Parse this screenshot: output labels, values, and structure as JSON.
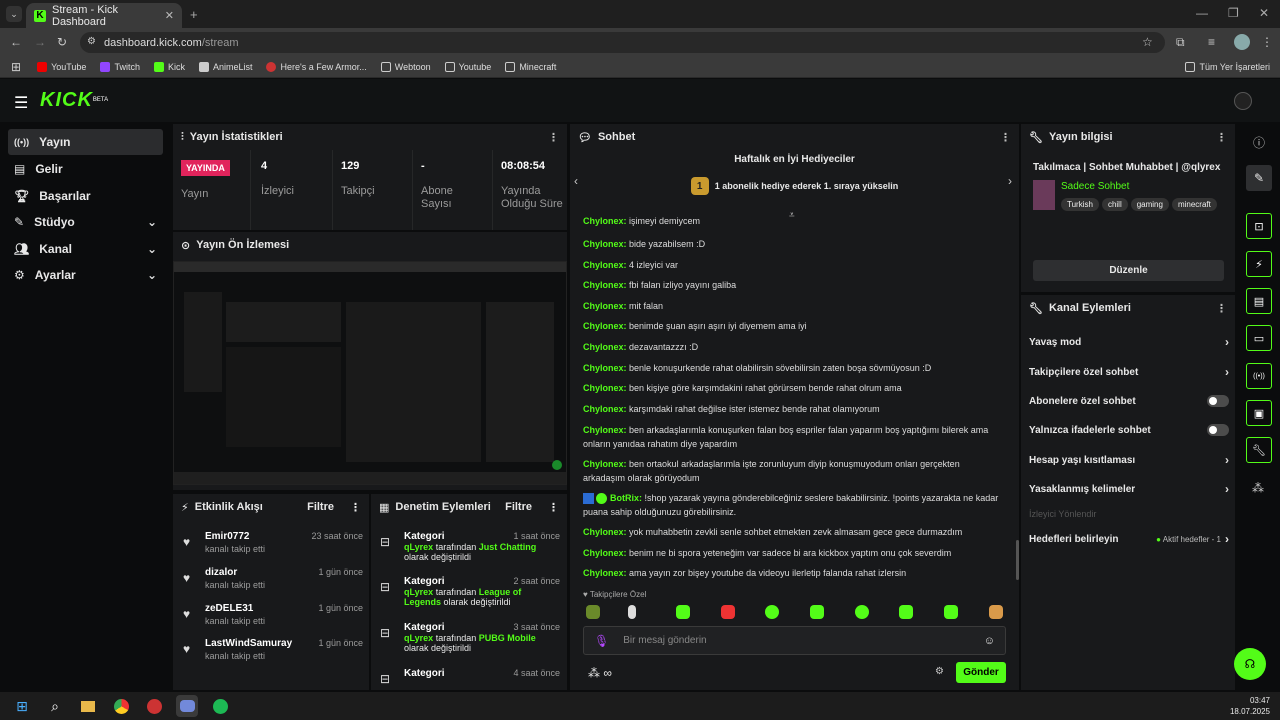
{
  "browser": {
    "tab_title": "Stream - Kick Dashboard",
    "url_domain": "dashboard.kick.com",
    "url_path": "/stream",
    "bookmarks": [
      "YouTube",
      "Twitch",
      "Kick",
      "AnimeList",
      "Here's a Few Armor...",
      "Webtoon",
      "Youtube",
      "Minecraft"
    ],
    "all_bookmarks": "Tüm Yer İşaretleri",
    "favicon_letter": "K"
  },
  "brand": {
    "logo": "KICK",
    "beta": "BETA",
    "accent": "#53fc18"
  },
  "sidebar": {
    "items": [
      {
        "label": "Yayın"
      },
      {
        "label": "Gelir"
      },
      {
        "label": "Başarılar"
      },
      {
        "label": "Stüdyo"
      },
      {
        "label": "Kanal"
      },
      {
        "label": "Ayarlar"
      }
    ]
  },
  "stats": {
    "title": "Yayın İstatistikleri",
    "badge": "YAYINDA",
    "status_label": "Yayın",
    "items": [
      {
        "value": "4",
        "label": "İzleyici"
      },
      {
        "value": "129",
        "label": "Takipçi"
      },
      {
        "value": "-",
        "label": "Abone Sayısı"
      },
      {
        "value": "08:08:54",
        "label": "Yayında Olduğu Süre"
      }
    ]
  },
  "preview": {
    "title": "Yayın Ön İzlemesi"
  },
  "activity": {
    "title": "Etkinlik Akışı",
    "filter": "Filtre",
    "items": [
      {
        "name": "Emir0772",
        "text": "kanalı takip etti",
        "time": "23 saat önce"
      },
      {
        "name": "dizalor",
        "text": "kanalı takip etti",
        "time": "1 gün önce"
      },
      {
        "name": "zeDELE31",
        "text": "kanalı takip etti",
        "time": "1 gün önce"
      },
      {
        "name": "LastWindSamuray",
        "text": "kanalı takip etti",
        "time": "1 gün önce"
      }
    ]
  },
  "moderation": {
    "title": "Denetim Eylemleri",
    "filter": "Filtre",
    "items": [
      {
        "title": "Kategori",
        "time": "1 saat önce",
        "user": "qLyrex",
        "mid": "tarafından",
        "game": "Just Chatting",
        "rest": "olarak değiştirildi"
      },
      {
        "title": "Kategori",
        "time": "2 saat önce",
        "user": "qLyrex",
        "mid": "tarafından",
        "game": "League of Legends",
        "rest": "olarak değiştirildi"
      },
      {
        "title": "Kategori",
        "time": "3 saat önce",
        "user": "qLyrex",
        "mid": "tarafından",
        "game": "PUBG Mobile",
        "rest": "olarak değiştirildi"
      },
      {
        "title": "Kategori",
        "time": "4 saat önce"
      }
    ]
  },
  "chat": {
    "title": "Sohbet",
    "gifter_title": "Haftalık en İyi Hediyeciler",
    "gifter_rank": "1",
    "gifter_text": "1 abonelik hediye ederek 1. sıraya yükselin",
    "messages": [
      {
        "user": "Chylonex:",
        "text": "bide yazabilsem :D"
      },
      {
        "user": "Chylonex:",
        "text": "4 izleyici var"
      },
      {
        "user": "Chylonex:",
        "text": "fbi falan izliyo yayını galiba"
      },
      {
        "user": "Chylonex:",
        "text": "mit falan"
      },
      {
        "user": "Chylonex:",
        "text": "benimde şuan aşırı aşırı iyi diyemem ama iyi"
      },
      {
        "user": "Chylonex:",
        "text": "dezavantazzzı :D"
      },
      {
        "user": "Chylonex:",
        "text": "benle konuşurkende rahat olabilirsin sövebilirsin zaten boşa sövmüyosun :D"
      },
      {
        "user": "Chylonex:",
        "text": "ben kişiye göre karşımdakini rahat görürsem bende rahat olrum ama"
      },
      {
        "user": "Chylonex:",
        "text": "karşımdaki rahat değilse ister istemez bende rahat olamıyorum"
      },
      {
        "user": "Chylonex:",
        "text": "ben arkadaşlarımla konuşurken falan boş espriler falan yaparım boş yaptığımı bilerek ama onların yanıdaa rahatım diye yapardım"
      },
      {
        "user": "Chylonex:",
        "text": "ben ortaokul arkadaşlarımla işte zorunluyum diyip konuşmuyodum onları gerçekten arkadaşım olarak görüyodum"
      },
      {
        "user": "BotRix:",
        "text": "!shop yazarak yayına gönderebilceğiniz seslere bakabilirsiniz. !points yazarakta ne kadar puana sahip olduğunuzu görebilirsiniz."
      },
      {
        "user": "Chylonex:",
        "text": "yok muhabbetin zevkli senle sohbet etmekten zevk almasam gece gece durmazdım"
      },
      {
        "user": "Chylonex:",
        "text": "benim ne bi spora yeteneğim var sadece bi ara kickbox yaptım onu çok severdim"
      },
      {
        "user": "Chylonex:",
        "text": "ama yayın zor bişey youtube da videoyu ilerletip falanda rahat izlersin"
      }
    ],
    "partial_msg": {
      "user": "Chylonex:",
      "text": "işimeyi demiycem"
    },
    "followers_only": "Takipçilere Özel",
    "input_placeholder": "Bir mesaj gönderin",
    "send": "Gönder"
  },
  "streaminfo": {
    "title": "Yayın bilgisi",
    "stream_title": "Takılmaca | Sohbet Muhabbet | @qlyrex",
    "category": "Sadece Sohbet",
    "tags": [
      "Turkish",
      "chill",
      "gaming",
      "minecraft"
    ],
    "edit": "Düzenle"
  },
  "actions": {
    "title": "Kanal Eylemleri",
    "items": [
      {
        "label": "Yavaş mod",
        "kind": "chevron"
      },
      {
        "label": "Takipçilere özel sohbet",
        "kind": "chevron"
      },
      {
        "label": "Abonelere özel sohbet",
        "kind": "toggle"
      },
      {
        "label": "Yalnızca ifadelerle sohbet",
        "kind": "toggle"
      },
      {
        "label": "Hesap yaşı kısıtlaması",
        "kind": "chevron"
      },
      {
        "label": "Yasaklanmış kelimeler",
        "kind": "chevron"
      }
    ],
    "viewer_redirect": "İzleyici Yönlendir",
    "targets": "Hedefleri belirleyin",
    "targets_status": "Aktif hedefler - 1"
  },
  "taskbar": {
    "time": "03:47",
    "date": "18.07.2025"
  }
}
